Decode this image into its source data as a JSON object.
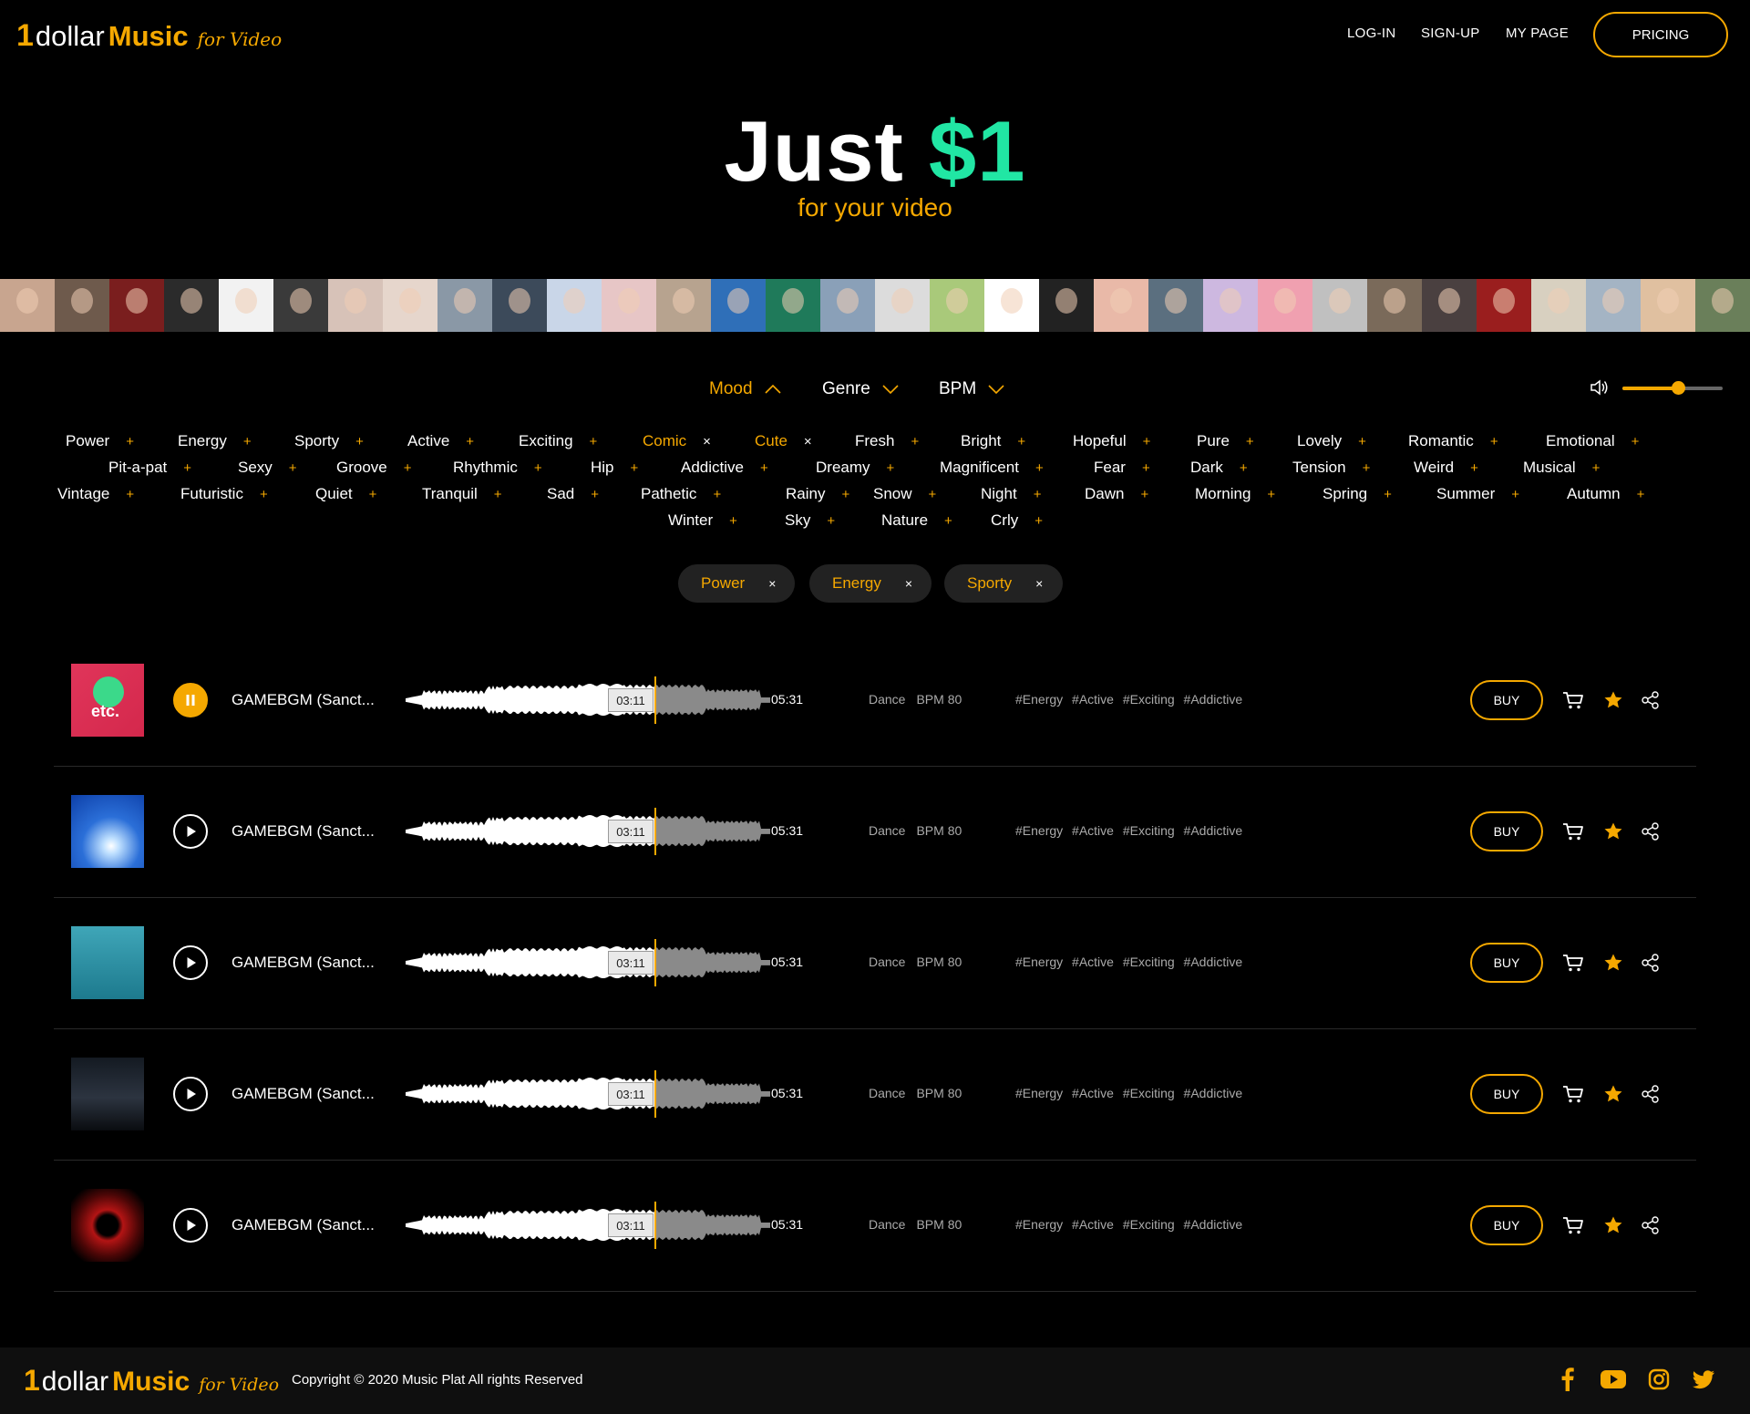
{
  "brand": {
    "one": "1",
    "dollar": "dollar",
    "music": "Music",
    "for_video": "for Video"
  },
  "nav": {
    "login": "LOG-IN",
    "signup": "SIGN-UP",
    "mypage": "MY PAGE",
    "pricing": "PRICING"
  },
  "hero": {
    "title_prefix": "Just ",
    "title_price": "$1",
    "subtitle": "for your video"
  },
  "filters": {
    "mood": "Mood",
    "genre": "Genre",
    "bpm": "BPM"
  },
  "volume": {
    "level": 0.55
  },
  "moods": [
    {
      "label": "Power",
      "mark": "+",
      "active": false
    },
    {
      "label": "Energy",
      "mark": "+",
      "active": false
    },
    {
      "label": "Sporty",
      "mark": "+",
      "active": false
    },
    {
      "label": "Active",
      "mark": "+",
      "active": false
    },
    {
      "label": "Exciting",
      "mark": "+",
      "active": false
    },
    {
      "label": "Comic",
      "mark": "×",
      "active": true
    },
    {
      "label": "Cute",
      "mark": "×",
      "active": true
    },
    {
      "label": "Fresh",
      "mark": "+",
      "active": false
    },
    {
      "label": "Bright",
      "mark": "+",
      "active": false
    },
    {
      "label": "Hopeful",
      "mark": "+",
      "active": false
    },
    {
      "label": "Pure",
      "mark": "+",
      "active": false
    },
    {
      "label": "Lovely",
      "mark": "+",
      "active": false
    },
    {
      "label": "Romantic",
      "mark": "+",
      "active": false
    },
    {
      "label": "Emotional",
      "mark": "+",
      "active": false
    },
    {
      "label": "Pit-a-pat",
      "mark": "+",
      "active": false
    },
    {
      "label": "Sexy",
      "mark": "+",
      "active": false
    },
    {
      "label": "Groove",
      "mark": "+",
      "active": false
    },
    {
      "label": "Rhythmic",
      "mark": "+",
      "active": false
    },
    {
      "label": "Hip",
      "mark": "+",
      "active": false
    },
    {
      "label": "Addictive",
      "mark": "+",
      "active": false
    },
    {
      "label": "Dreamy",
      "mark": "+",
      "active": false
    },
    {
      "label": "Magnificent",
      "mark": "+",
      "active": false
    },
    {
      "label": "Fear",
      "mark": "+",
      "active": false
    },
    {
      "label": "Dark",
      "mark": "+",
      "active": false
    },
    {
      "label": "Tension",
      "mark": "+",
      "active": false
    },
    {
      "label": "Weird",
      "mark": "+",
      "active": false
    },
    {
      "label": "Musical",
      "mark": "+",
      "active": false
    },
    {
      "label": "Vintage",
      "mark": "+",
      "active": false
    },
    {
      "label": "Futuristic",
      "mark": "+",
      "active": false
    },
    {
      "label": "Quiet",
      "mark": "+",
      "active": false
    },
    {
      "label": "Tranquil",
      "mark": "+",
      "active": false
    },
    {
      "label": "Sad",
      "mark": "+",
      "active": false
    },
    {
      "label": "Pathetic",
      "mark": "+",
      "active": false
    },
    {
      "label": "Rainy",
      "mark": "+",
      "active": false
    },
    {
      "label": "Snow",
      "mark": "+",
      "active": false
    },
    {
      "label": "Night",
      "mark": "+",
      "active": false
    },
    {
      "label": "Dawn",
      "mark": "+",
      "active": false
    },
    {
      "label": "Morning",
      "mark": "+",
      "active": false
    },
    {
      "label": "Spring",
      "mark": "+",
      "active": false
    },
    {
      "label": "Summer",
      "mark": "+",
      "active": false
    },
    {
      "label": "Autumn",
      "mark": "+",
      "active": false
    },
    {
      "label": "Winter",
      "mark": "+",
      "active": false
    },
    {
      "label": "Sky",
      "mark": "+",
      "active": false
    },
    {
      "label": "Nature",
      "mark": "+",
      "active": false
    },
    {
      "label": "Crly",
      "mark": "+",
      "active": false
    }
  ],
  "chips": [
    {
      "label": "Power",
      "close": "×"
    },
    {
      "label": "Energy",
      "close": "×"
    },
    {
      "label": "Sporty",
      "close": "×"
    }
  ],
  "tracks": [
    {
      "title": "GAMEBGM (Sanct...",
      "current": "03:11",
      "duration": "05:31",
      "genre": "Dance",
      "bpm": "BPM 80",
      "tags": "#Energy #Active #Exciting #Addictive",
      "buy": "BUY",
      "state": "playing",
      "cover_text": "etc."
    },
    {
      "title": "GAMEBGM (Sanct...",
      "current": "03:11",
      "duration": "05:31",
      "genre": "Dance",
      "bpm": "BPM 80",
      "tags": "#Energy #Active #Exciting #Addictive",
      "buy": "BUY",
      "state": "paused",
      "cover_text": ""
    },
    {
      "title": "GAMEBGM (Sanct...",
      "current": "03:11",
      "duration": "05:31",
      "genre": "Dance",
      "bpm": "BPM 80",
      "tags": "#Energy #Active #Exciting #Addictive",
      "buy": "BUY",
      "state": "paused",
      "cover_text": ""
    },
    {
      "title": "GAMEBGM (Sanct...",
      "current": "03:11",
      "duration": "05:31",
      "genre": "Dance",
      "bpm": "BPM 80",
      "tags": "#Energy #Active #Exciting #Addictive",
      "buy": "BUY",
      "state": "paused",
      "cover_text": ""
    },
    {
      "title": "GAMEBGM (Sanct...",
      "current": "03:11",
      "duration": "05:31",
      "genre": "Dance",
      "bpm": "BPM 80",
      "tags": "#Energy #Active #Exciting #Addictive",
      "buy": "BUY",
      "state": "paused",
      "cover_text": ""
    }
  ],
  "footer": {
    "copyright": "Copyright © 2020 Music Plat All rights Reserved"
  },
  "social": [
    "facebook-icon",
    "youtube-icon",
    "instagram-icon",
    "twitter-icon"
  ],
  "colors": {
    "accent": "#f5a800",
    "price": "#21e6a4",
    "background": "#000000"
  }
}
